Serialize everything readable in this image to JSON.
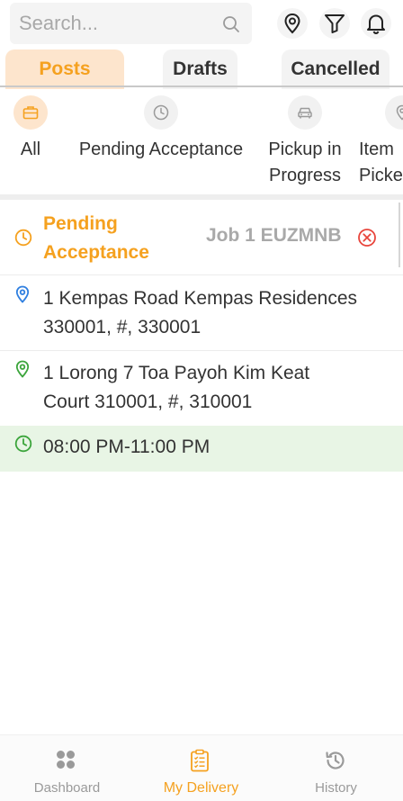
{
  "search": {
    "placeholder": "Search..."
  },
  "header_icons": [
    "location-pin-icon",
    "filter-icon",
    "bell-icon"
  ],
  "tabs": [
    {
      "label": "Posts",
      "active": true
    },
    {
      "label": "Drafts",
      "active": false
    },
    {
      "label": "Cancelled",
      "active": false
    }
  ],
  "status_filters": [
    {
      "label": "All",
      "icon": "briefcase-icon",
      "active": true
    },
    {
      "label": "Pending Acceptance",
      "icon": "clock-icon",
      "active": false
    },
    {
      "label": "Pickup in\nProgress",
      "icon": "car-icon",
      "active": false
    },
    {
      "label": "Item\nPicked",
      "icon": "location-pin-icon",
      "active": false
    }
  ],
  "job": {
    "status": "Pending\nAcceptance",
    "job_id": "Job 1 EUZMNB",
    "pickup_address": "1 Kempas Road Kempas Residences\n330001, #, 330001",
    "dropoff_address": "1 Lorong 7 Toa Payoh Kim Keat\nCourt 310001, #, 310001",
    "time_window": "08:00 PM-11:00 PM"
  },
  "bottom_nav": [
    {
      "label": "Dashboard",
      "icon": "dashboard-icon",
      "active": false
    },
    {
      "label": "My Delivery",
      "icon": "clipboard-icon",
      "active": true
    },
    {
      "label": "History",
      "icon": "history-icon",
      "active": false
    }
  ],
  "colors": {
    "accent": "#f5a11f",
    "accent_light": "#fde5cd",
    "pickup_pin": "#2f7fe0",
    "dropoff_pin": "#3ca53c",
    "time_bg": "#e8f5e5",
    "cancel": "#e8453c"
  }
}
